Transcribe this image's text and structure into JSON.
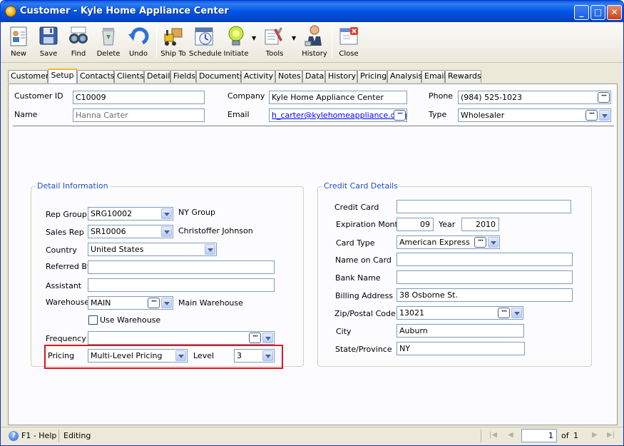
{
  "window": {
    "title": "Customer - Kyle Home Appliance Center",
    "minimize": "_",
    "maximize": "□",
    "close": "✕"
  },
  "toolbar": [
    {
      "label": "New",
      "icon": "new-customer-icon"
    },
    {
      "label": "Save",
      "icon": "save-icon"
    },
    {
      "label": "Find",
      "icon": "find-binoculars-icon"
    },
    {
      "label": "Delete",
      "icon": "delete-recycle-icon"
    },
    {
      "label": "Undo",
      "icon": "undo-icon"
    },
    {
      "label": "Ship To",
      "icon": "ship-to-forklift-icon"
    },
    {
      "label": "Schedule",
      "icon": "schedule-calendar-icon"
    },
    {
      "label": "Initiate",
      "icon": "initiate-lamp-icon"
    },
    {
      "label": "Tools",
      "icon": "tools-icon"
    },
    {
      "label": "History",
      "icon": "history-person-icon"
    },
    {
      "label": "Close",
      "icon": "close-window-icon"
    }
  ],
  "tabs": [
    "Customer",
    "Setup",
    "Contacts",
    "Clients",
    "Detail",
    "Fields",
    "Documents",
    "Activity",
    "Notes",
    "Data",
    "History",
    "Pricing",
    "Analysis",
    "Email",
    "Rewards"
  ],
  "active_tab": "Setup",
  "header": {
    "customer_id_label": "Customer ID",
    "customer_id": "C10009",
    "name_label": "Name",
    "name": "Hanna Carter",
    "company_label": "Company",
    "company": "Kyle Home Appliance Center",
    "email_label": "Email",
    "email": "h_carter@kylehomeappliance.com",
    "phone_label": "Phone",
    "phone": "(984) 525-1023",
    "type_label": "Type",
    "type": "Wholesaler"
  },
  "detail": {
    "title": "Detail Information",
    "rep_group_label": "Rep Group",
    "rep_group": "SRG10002",
    "rep_group_name": "NY Group",
    "sales_rep_label": "Sales Rep",
    "sales_rep": "SR10006",
    "sales_rep_name": "Christoffer Johnson",
    "country_label": "Country",
    "country": "United States",
    "referred_by_label": "Referred By",
    "referred_by": "",
    "assistant_label": "Assistant",
    "assistant": "",
    "warehouse_label": "Warehouse",
    "warehouse": "MAIN",
    "warehouse_name": "Main Warehouse",
    "use_warehouse_label": "Use Warehouse",
    "frequency_label": "Frequency",
    "frequency": "",
    "pricing_label": "Pricing",
    "pricing": "Multi-Level Pricing",
    "level_label": "Level",
    "level": "3"
  },
  "credit": {
    "title": "Credit Card Details",
    "credit_card_label": "Credit Card",
    "credit_card": "",
    "exp_month_label": "Expiration Month",
    "exp_month": "09",
    "year_label": "Year",
    "year": "2010",
    "card_type_label": "Card Type",
    "card_type": "American Express",
    "name_on_card_label": "Name on Card",
    "name_on_card": "",
    "bank_name_label": "Bank Name",
    "bank_name": "",
    "billing_address_label": "Billing Address",
    "billing_address": "38 Osborne St.",
    "zip_label": "Zip/Postal Code",
    "zip": "13021",
    "city_label": "City",
    "city": "Auburn",
    "state_label": "State/Province",
    "state": "NY"
  },
  "status": {
    "help": "F1 - Help",
    "mode": "Editing",
    "page": "1",
    "of_label": "of",
    "total": "1"
  },
  "colors": {
    "title_bar": "#0055e5",
    "group_title": "#1e50c8",
    "highlight": "#e0141e",
    "active_tab_accent": "#f8b534"
  }
}
